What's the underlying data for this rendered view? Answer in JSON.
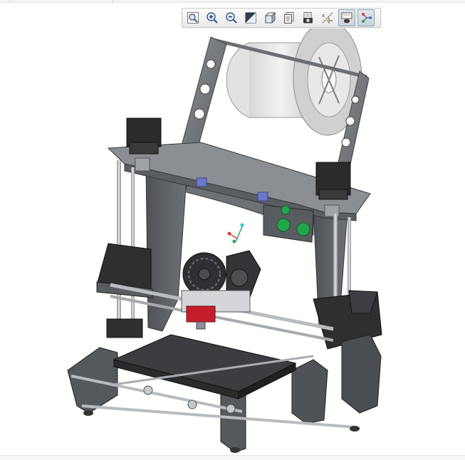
{
  "toolbar": {
    "buttons": [
      {
        "icon": "zoom-fit-icon",
        "active": false
      },
      {
        "icon": "zoom-in-icon",
        "active": false
      },
      {
        "icon": "zoom-out-icon",
        "active": false
      },
      {
        "icon": "display-style-icon",
        "active": false,
        "has_menu": true
      },
      {
        "icon": "saved-views-icon",
        "active": false,
        "has_menu": true
      },
      {
        "icon": "view-manager-icon",
        "active": false,
        "has_menu": true
      },
      {
        "icon": "snapshot-icon",
        "active": false
      },
      {
        "icon": "datum-display-icon",
        "active": false,
        "has_menu": true
      },
      {
        "icon": "spin-center-icon",
        "active": true
      },
      {
        "icon": "csys-display-icon",
        "active": true
      }
    ]
  },
  "viewport": {
    "model": "3d-printer-assembly",
    "background": "#ffffff",
    "colors": {
      "frame": "#7d7f82",
      "frame_dark": "#4c4e51",
      "motor": "#2b2b2b",
      "rod": "#b8bcc0",
      "spool": "#d7d7d7",
      "bed": "#3a3a3a",
      "accent_red": "#c41e2a",
      "accent_green": "#22a64a",
      "accent_blue": "#6a78c8"
    }
  }
}
